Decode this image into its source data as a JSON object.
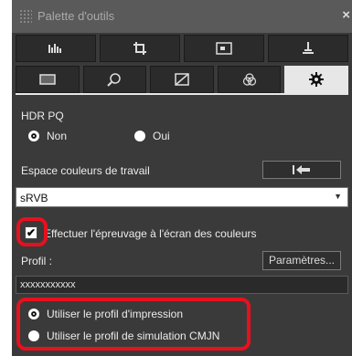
{
  "window": {
    "title": "Palette d'outils"
  },
  "toolbar": {
    "row1": [
      {
        "icon": "histogram-icon"
      },
      {
        "icon": "crop-icon"
      },
      {
        "icon": "image-view-icon"
      },
      {
        "icon": "stamp-icon"
      }
    ],
    "row2": [
      {
        "icon": "basic-adjust-icon"
      },
      {
        "icon": "zoom-detail-icon"
      },
      {
        "icon": "tone-curve-icon"
      },
      {
        "icon": "color-adjust-icon"
      },
      {
        "icon": "settings-gear-icon",
        "active": true
      }
    ]
  },
  "hdr": {
    "label": "HDR PQ",
    "option_no": "Non",
    "option_yes": "Oui",
    "selected": "Non"
  },
  "workspace": {
    "label": "Espace couleurs de travail",
    "value": "sRVB"
  },
  "soft_proof": {
    "label": "Effectuer l'épreuvage à l'écran des couleurs",
    "checked": true
  },
  "profile": {
    "label": "Profil :",
    "settings_button": "Paramètres...",
    "value": "xxxxxxxxxxx"
  },
  "profile_mode": {
    "print": "Utiliser le profil d'impression",
    "cmyk": "Utiliser le profil de simulation CMJN",
    "selected": "print"
  },
  "colors": {
    "panel_bg": "#3a3a3a",
    "titlebar_bg": "#5a5a5a",
    "highlight": "#e8101e"
  }
}
